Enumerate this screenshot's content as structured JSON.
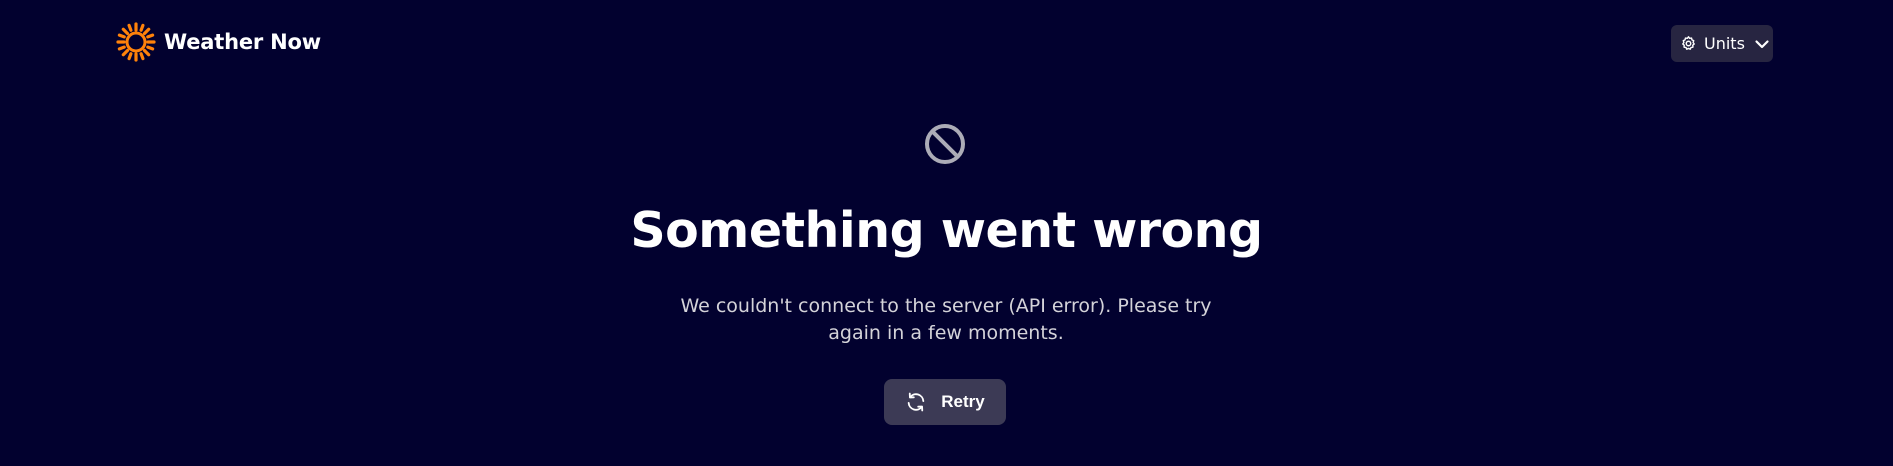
{
  "app": {
    "name": "Weather Now",
    "logo_icon": "sun-logo-icon",
    "accent_color": "#ff820a"
  },
  "header": {
    "units_button": {
      "label": "Units",
      "icon": "gear-icon",
      "dropdown_icon": "chevron-down-icon"
    }
  },
  "error": {
    "icon": "no-entry-icon",
    "title": "Something went wrong",
    "message": "We couldn't connect to the server (API error). Please try again in a few moments.",
    "retry_button": {
      "label": "Retry",
      "icon": "refresh-icon"
    }
  },
  "colors": {
    "background": "#02012f",
    "button_background": "#272541",
    "retry_background": "#3c3a55",
    "text_primary": "#ffffff",
    "text_secondary": "#d4d3d9",
    "icon_muted": "#acacb7"
  }
}
